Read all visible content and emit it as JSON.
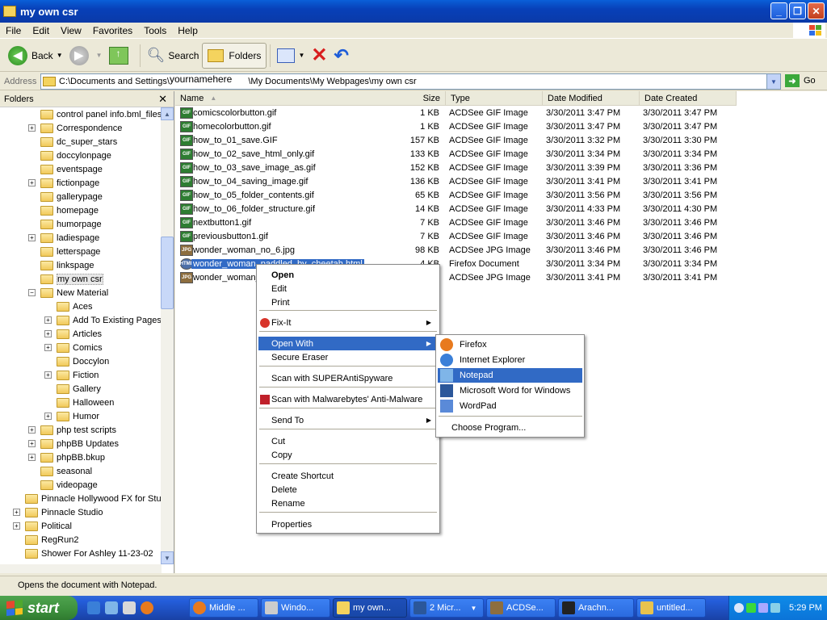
{
  "window": {
    "title": "my own csr"
  },
  "menubar": [
    "File",
    "Edit",
    "View",
    "Favorites",
    "Tools",
    "Help"
  ],
  "toolbar": {
    "back": "Back",
    "search": "Search",
    "folders": "Folders"
  },
  "address": {
    "label": "Address",
    "path_part1": "C:\\Documents and Settings\\",
    "path_user": "yournamehere",
    "path_part2": "\\My Documents\\My Webpages\\my own csr",
    "go": "Go"
  },
  "folders_pane": {
    "header": "Folders",
    "items": [
      {
        "label": "control panel info.bml_files",
        "expander": ""
      },
      {
        "label": "Correspondence",
        "expander": "+"
      },
      {
        "label": "dc_super_stars",
        "expander": ""
      },
      {
        "label": "doccylonpage",
        "expander": ""
      },
      {
        "label": "eventspage",
        "expander": ""
      },
      {
        "label": "fictionpage",
        "expander": "+"
      },
      {
        "label": "gallerypage",
        "expander": ""
      },
      {
        "label": "homepage",
        "expander": ""
      },
      {
        "label": "humorpage",
        "expander": ""
      },
      {
        "label": "ladiespage",
        "expander": "+"
      },
      {
        "label": "letterspage",
        "expander": ""
      },
      {
        "label": "linkspage",
        "expander": ""
      },
      {
        "label": "my own csr",
        "expander": ""
      },
      {
        "label": "New Material",
        "expander": "−"
      },
      {
        "label": "Aces",
        "expander": ""
      },
      {
        "label": "Add To Existing Pages",
        "expander": "+"
      },
      {
        "label": "Articles",
        "expander": "+"
      },
      {
        "label": "Comics",
        "expander": "+"
      },
      {
        "label": "Doccylon",
        "expander": ""
      },
      {
        "label": "Fiction",
        "expander": "+"
      },
      {
        "label": "Gallery",
        "expander": ""
      },
      {
        "label": "Halloween",
        "expander": ""
      },
      {
        "label": "Humor",
        "expander": "+"
      },
      {
        "label": "php test scripts",
        "expander": "+"
      },
      {
        "label": "phpBB Updates",
        "expander": "+"
      },
      {
        "label": "phpBB.bkup",
        "expander": "+"
      },
      {
        "label": "seasonal",
        "expander": ""
      },
      {
        "label": "videopage",
        "expander": ""
      },
      {
        "label": "Pinnacle Hollywood FX for Studio",
        "expander": ""
      },
      {
        "label": "Pinnacle Studio",
        "expander": "+"
      },
      {
        "label": "Political",
        "expander": "+"
      },
      {
        "label": "RegRun2",
        "expander": ""
      },
      {
        "label": "Shower For Ashley 11-23-02",
        "expander": ""
      }
    ]
  },
  "columns": [
    "Name",
    "Size",
    "Type",
    "Date Modified",
    "Date Created"
  ],
  "files": [
    {
      "name": "comicscolorbutton.gif",
      "size": "1 KB",
      "type": "ACDSee GIF Image",
      "modified": "3/30/2011 3:47 PM",
      "created": "3/30/2011 3:47 PM",
      "kind": "GIF"
    },
    {
      "name": "homecolorbutton.gif",
      "size": "1 KB",
      "type": "ACDSee GIF Image",
      "modified": "3/30/2011 3:47 PM",
      "created": "3/30/2011 3:47 PM",
      "kind": "GIF"
    },
    {
      "name": "how_to_01_save.GIF",
      "size": "157 KB",
      "type": "ACDSee GIF Image",
      "modified": "3/30/2011 3:32 PM",
      "created": "3/30/2011 3:30 PM",
      "kind": "GIF"
    },
    {
      "name": "how_to_02_save_html_only.gif",
      "size": "133 KB",
      "type": "ACDSee GIF Image",
      "modified": "3/30/2011 3:34 PM",
      "created": "3/30/2011 3:34 PM",
      "kind": "GIF"
    },
    {
      "name": "how_to_03_save_image_as.gif",
      "size": "152 KB",
      "type": "ACDSee GIF Image",
      "modified": "3/30/2011 3:39 PM",
      "created": "3/30/2011 3:36 PM",
      "kind": "GIF"
    },
    {
      "name": "how_to_04_saving_image.gif",
      "size": "136 KB",
      "type": "ACDSee GIF Image",
      "modified": "3/30/2011 3:41 PM",
      "created": "3/30/2011 3:41 PM",
      "kind": "GIF"
    },
    {
      "name": "how_to_05_folder_contents.gif",
      "size": "65 KB",
      "type": "ACDSee GIF Image",
      "modified": "3/30/2011 3:56 PM",
      "created": "3/30/2011 3:56 PM",
      "kind": "GIF"
    },
    {
      "name": "how_to_06_folder_structure.gif",
      "size": "14 KB",
      "type": "ACDSee GIF Image",
      "modified": "3/30/2011 4:33 PM",
      "created": "3/30/2011 4:30 PM",
      "kind": "GIF"
    },
    {
      "name": "nextbutton1.gif",
      "size": "7 KB",
      "type": "ACDSee GIF Image",
      "modified": "3/30/2011 3:46 PM",
      "created": "3/30/2011 3:46 PM",
      "kind": "GIF"
    },
    {
      "name": "previousbutton1.gif",
      "size": "7 KB",
      "type": "ACDSee GIF Image",
      "modified": "3/30/2011 3:46 PM",
      "created": "3/30/2011 3:46 PM",
      "kind": "GIF"
    },
    {
      "name": "wonder_woman_no_6.jpg",
      "size": "98 KB",
      "type": "ACDSee JPG Image",
      "modified": "3/30/2011 3:46 PM",
      "created": "3/30/2011 3:46 PM",
      "kind": "JPG"
    },
    {
      "name": "wonder_woman_paddled_by_cheetah.html",
      "size": "4 KB",
      "type": "Firefox Document",
      "modified": "3/30/2011 3:34 PM",
      "created": "3/30/2011 3:34 PM",
      "kind": "HTML"
    },
    {
      "name": "wonder_woman_",
      "size": "",
      "type": "ACDSee JPG Image",
      "modified": "3/30/2011 3:41 PM",
      "created": "3/30/2011 3:41 PM",
      "kind": "JPG"
    }
  ],
  "context_menu": {
    "items": [
      "Open",
      "Edit",
      "Print",
      "Fix-It",
      "Open With",
      "Secure Eraser",
      "Scan with SUPERAntiSpyware",
      "Scan with Malwarebytes' Anti-Malware",
      "Send To",
      "Cut",
      "Copy",
      "Create Shortcut",
      "Delete",
      "Rename",
      "Properties"
    ]
  },
  "open_with_menu": {
    "items": [
      "Firefox",
      "Internet Explorer",
      "Notepad",
      "Microsoft Word for Windows",
      "WordPad",
      "Choose Program..."
    ]
  },
  "statusbar": {
    "text": "Opens the document with Notepad."
  },
  "taskbar": {
    "start": "start",
    "tasks": [
      "Middle ...",
      "Windo...",
      "my own...",
      "2 Micr...",
      "ACDSe...",
      "Arachn...",
      "untitled..."
    ],
    "clock": "5:29 PM"
  },
  "colors": {
    "selection": "#316ac5",
    "titlebar": "#0a5fd8",
    "taskbar": "#245edb",
    "start": "#3c8f3c"
  }
}
